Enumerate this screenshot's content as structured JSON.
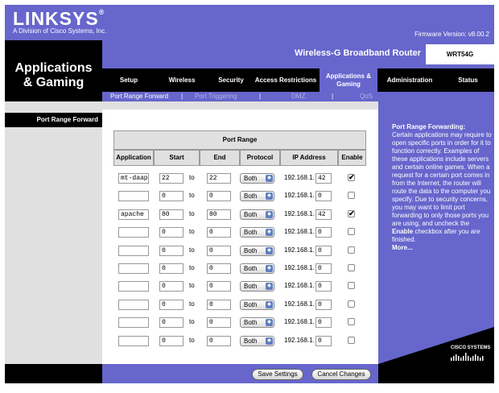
{
  "brand": {
    "logo": "LINKSYS",
    "reg": "®",
    "subtitle": "A Division of Cisco Systems, Inc.",
    "firmware": "Firmware Version: v8.00.2"
  },
  "header": {
    "section_title_1": "Applications",
    "section_title_2": "& Gaming",
    "product_name": "Wireless-G Broadband Router",
    "model": "WRT54G"
  },
  "tabs": [
    {
      "label": "Setup"
    },
    {
      "label": "Wireless"
    },
    {
      "label": "Security"
    },
    {
      "label": "Access Restrictions"
    },
    {
      "label": "Applications & Gaming"
    },
    {
      "label": "Administration"
    },
    {
      "label": "Status"
    }
  ],
  "subtabs": [
    {
      "label": "Port Range Forward"
    },
    {
      "label": "Port Triggering"
    },
    {
      "label": "DMZ"
    },
    {
      "label": "QoS"
    }
  ],
  "separator": "|",
  "left": {
    "page_label": "Port Range Forward"
  },
  "table": {
    "group_header": "Port Range",
    "columns": [
      "Application",
      "Start",
      "End",
      "Protocol",
      "IP Address",
      "Enable"
    ],
    "to_label": "to",
    "ip_prefix": "192.168.1.",
    "rows": [
      {
        "application": "mt-daap",
        "start": "22",
        "end": "22",
        "protocol": "Both",
        "ip_last": "42",
        "enabled": true
      },
      {
        "application": "",
        "start": "0",
        "end": "0",
        "protocol": "Both",
        "ip_last": "0",
        "enabled": false
      },
      {
        "application": "apache",
        "start": "80",
        "end": "80",
        "protocol": "Both",
        "ip_last": "42",
        "enabled": true
      },
      {
        "application": "",
        "start": "0",
        "end": "0",
        "protocol": "Both",
        "ip_last": "0",
        "enabled": false
      },
      {
        "application": "",
        "start": "0",
        "end": "0",
        "protocol": "Both",
        "ip_last": "0",
        "enabled": false
      },
      {
        "application": "",
        "start": "0",
        "end": "0",
        "protocol": "Both",
        "ip_last": "0",
        "enabled": false
      },
      {
        "application": "",
        "start": "0",
        "end": "0",
        "protocol": "Both",
        "ip_last": "0",
        "enabled": false
      },
      {
        "application": "",
        "start": "0",
        "end": "0",
        "protocol": "Both",
        "ip_last": "0",
        "enabled": false
      },
      {
        "application": "",
        "start": "0",
        "end": "0",
        "protocol": "Both",
        "ip_last": "0",
        "enabled": false
      },
      {
        "application": "",
        "start": "0",
        "end": "0",
        "protocol": "Both",
        "ip_last": "0",
        "enabled": false
      }
    ]
  },
  "help": {
    "title": "Port Range Forwarding:",
    "text_1": "Certain applications may require to open specific ports in order for it to function correctly. Examples of these applications include servers and certain online games. When a request for a certain port comes in from the Internet, the router will route the data to the computer you specify. Due to security concerns, you may want to limit port forwarding to only those ports you are using, and uncheck the ",
    "text_bold": "Enable",
    "text_2": " checkbox after you are finished.",
    "more": "More..."
  },
  "cisco": {
    "label": "CISCO SYSTEMS"
  },
  "buttons": {
    "save": "Save Settings",
    "cancel": "Cancel Changes"
  },
  "icons": {
    "select_arrow": "select-arrow-icon",
    "checkmark": "checkmark-icon"
  },
  "colors": {
    "brand_purple": "#6666cc",
    "black": "#000000",
    "panel_gray": "#e0e0e0"
  }
}
